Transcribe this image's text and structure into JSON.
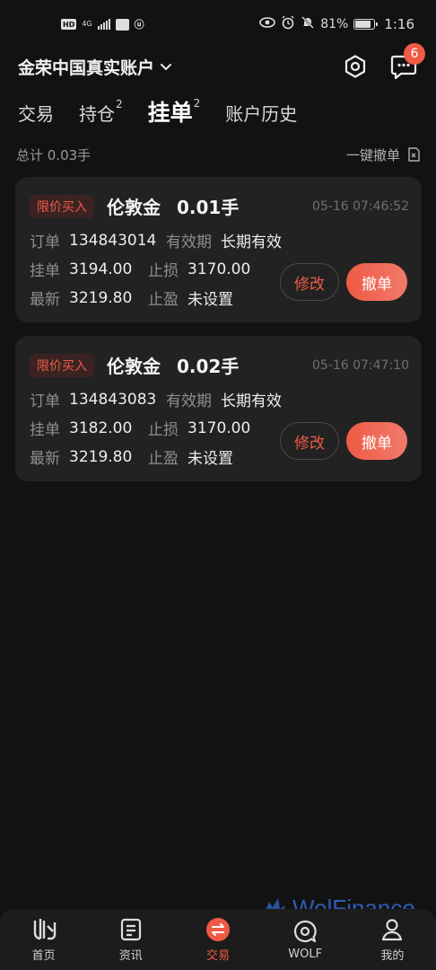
{
  "status_bar": {
    "hd": "HD",
    "network": "4G",
    "battery_percent": "81%",
    "battery_level": 0.81,
    "time": "1:16"
  },
  "header": {
    "account_title": "金荣中国真实账户",
    "notification_count": "6"
  },
  "tabs": [
    {
      "label": "交易",
      "count": ""
    },
    {
      "label": "持仓",
      "count": "2"
    },
    {
      "label": "挂单",
      "count": "2"
    },
    {
      "label": "账户历史",
      "count": ""
    }
  ],
  "summary": {
    "total": "总计 0.03手",
    "cancel_all": "一键撤单"
  },
  "orders": [
    {
      "tag": "限价买入",
      "symbol": "伦敦金",
      "lots": "0.01手",
      "time": "05-16 07:46:52",
      "order_label": "订单",
      "order_no": "134843014",
      "validity_label": "有效期",
      "validity": "长期有效",
      "pending_label": "挂单",
      "pending_price": "3194.00",
      "sl_label": "止损",
      "sl": "3170.00",
      "latest_label": "最新",
      "latest_price": "3219.80",
      "tp_label": "止盈",
      "tp": "未设置",
      "modify_label": "修改",
      "cancel_label": "撤单"
    },
    {
      "tag": "限价买入",
      "symbol": "伦敦金",
      "lots": "0.02手",
      "time": "05-16 07:47:10",
      "order_label": "订单",
      "order_no": "134843083",
      "validity_label": "有效期",
      "validity": "长期有效",
      "pending_label": "挂单",
      "pending_price": "3182.00",
      "sl_label": "止损",
      "sl": "3170.00",
      "latest_label": "最新",
      "latest_price": "3219.80",
      "tp_label": "止盈",
      "tp": "未设置",
      "modify_label": "修改",
      "cancel_label": "撤单"
    }
  ],
  "bottom_nav": [
    {
      "label": "首页",
      "icon": "home-logo-icon"
    },
    {
      "label": "资讯",
      "icon": "news-icon"
    },
    {
      "label": "交易",
      "icon": "trade-swap-icon"
    },
    {
      "label": "WOLF",
      "icon": "wolf-chat-icon"
    },
    {
      "label": "我的",
      "icon": "profile-icon"
    }
  ],
  "watermark": "WolFinance",
  "colors": {
    "accent": "#ef5a45",
    "background": "#121212",
    "card": "#222222"
  }
}
